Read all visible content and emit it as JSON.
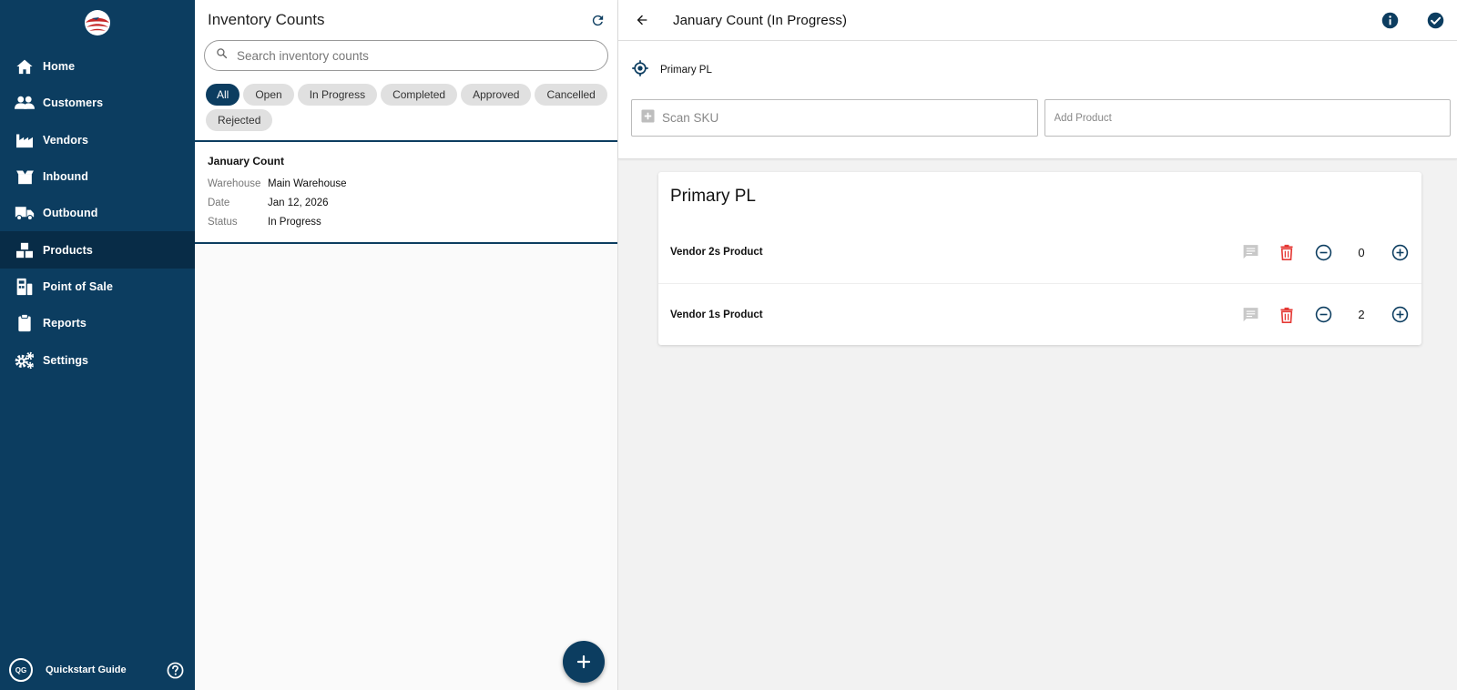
{
  "sidebar": {
    "items": [
      {
        "label": "Home",
        "icon": "home-icon"
      },
      {
        "label": "Customers",
        "icon": "people-icon"
      },
      {
        "label": "Vendors",
        "icon": "factory-icon"
      },
      {
        "label": "Inbound",
        "icon": "open-box-icon"
      },
      {
        "label": "Outbound",
        "icon": "truck-icon"
      },
      {
        "label": "Products",
        "icon": "boxes-icon"
      },
      {
        "label": "Point of Sale",
        "icon": "register-icon"
      },
      {
        "label": "Reports",
        "icon": "clipboard-icon"
      },
      {
        "label": "Settings",
        "icon": "gears-icon"
      }
    ],
    "active": "Products",
    "footer": {
      "badge": "QG",
      "label": "Quickstart Guide"
    }
  },
  "list": {
    "title": "Inventory Counts",
    "search_placeholder": "Search inventory counts",
    "filters": [
      "All",
      "Open",
      "In Progress",
      "Completed",
      "Approved",
      "Cancelled",
      "Rejected"
    ],
    "active_filter": "All",
    "cards": [
      {
        "title": "January Count",
        "fields": [
          {
            "k": "Warehouse",
            "v": "Main Warehouse"
          },
          {
            "k": "Date",
            "v": "Jan 12, 2026"
          },
          {
            "k": "Status",
            "v": "In Progress"
          }
        ]
      }
    ]
  },
  "detail": {
    "title": "January Count (In Progress)",
    "location": "Primary PL",
    "scan_placeholder": "Scan SKU",
    "add_placeholder": "Add Product",
    "section_title": "Primary PL",
    "products": [
      {
        "name": "Vendor 2s Product",
        "qty": "0"
      },
      {
        "name": "Vendor 1s Product",
        "qty": "2"
      }
    ]
  },
  "colors": {
    "primary": "#0c3d60",
    "danger": "#e53935",
    "muted_icon": "#c8c8c8"
  }
}
